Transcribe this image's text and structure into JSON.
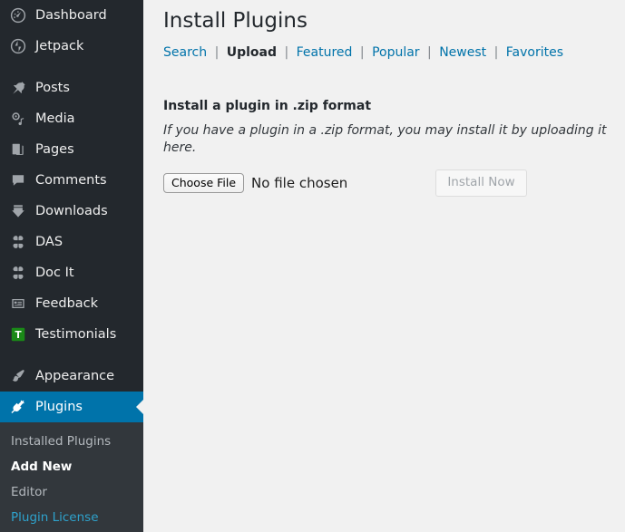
{
  "colors": {
    "sidebar_bg": "#23282d",
    "submenu_bg": "#32373c",
    "accent_blue": "#0073aa",
    "link_blue": "#2ea2cc",
    "content_bg": "#f1f1f1",
    "testimonials_green": "#1a8917"
  },
  "sidebar": {
    "groups": [
      {
        "items": [
          {
            "label": "Dashboard",
            "icon": "dashboard-gauge-icon",
            "current": false
          },
          {
            "label": "Jetpack",
            "icon": "jetpack-icon",
            "current": false
          }
        ]
      },
      {
        "items": [
          {
            "label": "Posts",
            "icon": "pushpin-icon",
            "current": false
          },
          {
            "label": "Media",
            "icon": "media-icon",
            "current": false
          },
          {
            "label": "Pages",
            "icon": "pages-icon",
            "current": false
          },
          {
            "label": "Comments",
            "icon": "comment-bubble-icon",
            "current": false
          },
          {
            "label": "Downloads",
            "icon": "download-icon",
            "current": false
          },
          {
            "label": "DAS",
            "icon": "clover-plugin-icon",
            "current": false
          },
          {
            "label": "Doc It",
            "icon": "clover-plugin-icon",
            "current": false
          },
          {
            "label": "Feedback",
            "icon": "feedback-form-icon",
            "current": false
          },
          {
            "label": "Testimonials",
            "icon": "testimonials-t-icon",
            "current": false
          }
        ]
      },
      {
        "items": [
          {
            "label": "Appearance",
            "icon": "paintbrush-icon",
            "current": false
          },
          {
            "label": "Plugins",
            "icon": "plug-icon",
            "current": true
          }
        ]
      }
    ],
    "submenu": [
      {
        "label": "Installed Plugins",
        "state": "normal"
      },
      {
        "label": "Add New",
        "state": "current"
      },
      {
        "label": "Editor",
        "state": "normal"
      },
      {
        "label": "Plugin License",
        "state": "link"
      }
    ]
  },
  "main": {
    "title": "Install Plugins",
    "tabs": [
      {
        "label": "Search",
        "current": false
      },
      {
        "label": "Upload",
        "current": true
      },
      {
        "label": "Featured",
        "current": false
      },
      {
        "label": "Popular",
        "current": false
      },
      {
        "label": "Newest",
        "current": false
      },
      {
        "label": "Favorites",
        "current": false
      }
    ],
    "tab_separator": "|",
    "upload": {
      "heading": "Install a plugin in .zip format",
      "description": "If you have a plugin in a .zip format, you may install it by uploading it here.",
      "choose_file_label": "Choose File",
      "file_status": "No file chosen",
      "install_button_label": "Install Now"
    }
  }
}
